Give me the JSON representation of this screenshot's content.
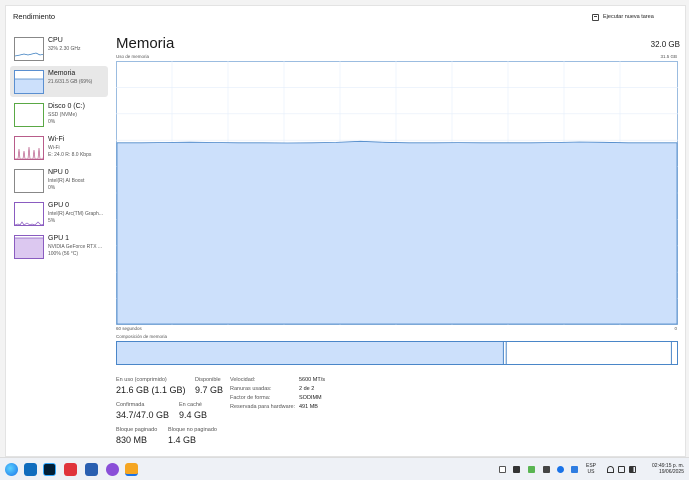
{
  "window": {
    "title": "Rendimiento",
    "run_task_label": "Ejecutar nueva tarea"
  },
  "sidebar": {
    "items": [
      {
        "name": "CPU",
        "sub1": "32%  2.30 GHz",
        "sub2": "",
        "active": false
      },
      {
        "name": "Memoria",
        "sub1": "21.6/31.5 GB (69%)",
        "sub2": "",
        "active": true
      },
      {
        "name": "Disco 0 (C:)",
        "sub1": "SSD (NVMe)",
        "sub2": "0%",
        "active": false
      },
      {
        "name": "Wi-Fi",
        "sub1": "Wi-Fi",
        "sub2": "E: 24.0  R: 8.0 Kbps",
        "active": false
      },
      {
        "name": "NPU 0",
        "sub1": "Intel(R) AI Boost",
        "sub2": "0%",
        "active": false
      },
      {
        "name": "GPU 0",
        "sub1": "Intel(R) Arc(TM) Graph...",
        "sub2": "5%",
        "active": false
      },
      {
        "name": "GPU 1",
        "sub1": "NVIDIA GeForce RTX ...",
        "sub2": "100%  (56 °C)",
        "active": false
      }
    ]
  },
  "main": {
    "title": "Memoria",
    "total": "32.0 GB",
    "graph_label": "Uso de memoria",
    "graph_max": "31.5 GB",
    "axis_left": "60 segundos",
    "axis_right": "0",
    "composition_label": "Composición de memoria",
    "usage_fraction": 0.69,
    "composition": {
      "in_use": 0.69,
      "modified": 0.005,
      "standby": 0.295,
      "free": 0.01
    }
  },
  "stats": {
    "in_use_label": "En uso (comprimido)",
    "in_use_value": "21.6 GB (1.1 GB)",
    "available_label": "Disponible",
    "available_value": "9.7 GB",
    "committed_label": "Confirmada",
    "committed_value": "34.7/47.0 GB",
    "cached_label": "En caché",
    "cached_value": "9.4 GB",
    "paged_label": "Bloque paginado",
    "paged_value": "830 MB",
    "nonpaged_label": "Bloque no paginado",
    "nonpaged_value": "1.4 GB",
    "speed_label": "Velocidad:",
    "speed_value": "5600 MT/s",
    "slots_label": "Ranuras usadas:",
    "slots_value": "2 de 2",
    "form_label": "Factor de forma:",
    "form_value": "SODIMM",
    "reserved_label": "Reservada para hardware:",
    "reserved_value": "491 MB"
  },
  "taskbar": {
    "lang_top": "ESP",
    "lang_bottom": "US",
    "time": "02:49:15 p. m.",
    "date": "19/06/2025",
    "colors": {
      "accent": "#1a73e8",
      "graph_fill": "#cce0fb",
      "graph_line": "#4a86c8"
    }
  }
}
